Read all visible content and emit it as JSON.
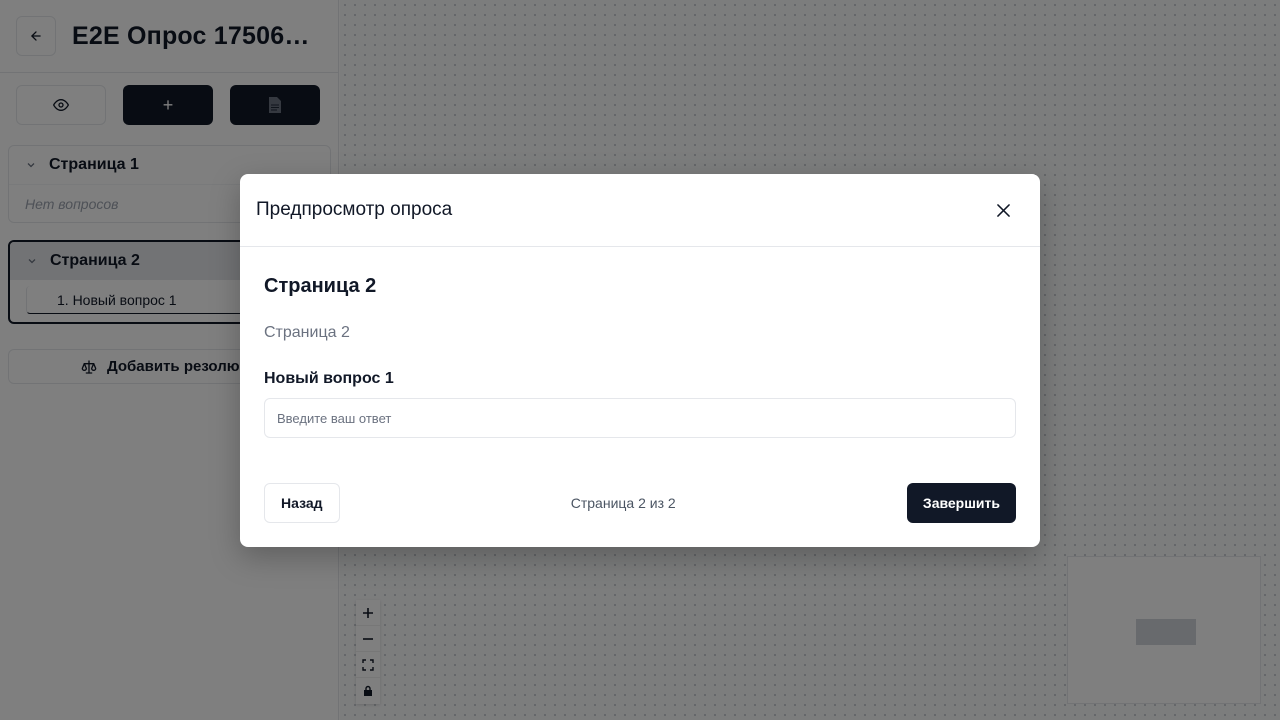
{
  "sidebar": {
    "title": "E2E Опрос 175060...",
    "tools": {
      "preview_icon": "eye-icon",
      "add_label": "+",
      "doc_icon": "document-icon"
    },
    "pages": [
      {
        "label": "Страница 1",
        "empty_text": "Нет вопросов"
      },
      {
        "label": "Страница 2",
        "questions": [
          "1. Новый вопрос 1"
        ]
      }
    ],
    "add_resolution_label": "Добавить резолюци"
  },
  "canvas": {
    "zoom_controls": [
      "plus-icon",
      "minus-icon",
      "fit-view-icon",
      "lock-icon"
    ]
  },
  "modal": {
    "title": "Предпросмотр опроса",
    "page_title": "Страница 2",
    "page_description": "Страница 2",
    "question_label": "Новый вопрос 1",
    "answer_placeholder": "Введите ваш ответ",
    "answer_value": "",
    "back_label": "Назад",
    "pager_text": "Страница 2 из 2",
    "finish_label": "Завершить"
  },
  "colors": {
    "primary": "#111827",
    "border": "#e5e7eb",
    "muted": "#6b7280",
    "overlay": "rgba(0,0,0,0.5)"
  }
}
